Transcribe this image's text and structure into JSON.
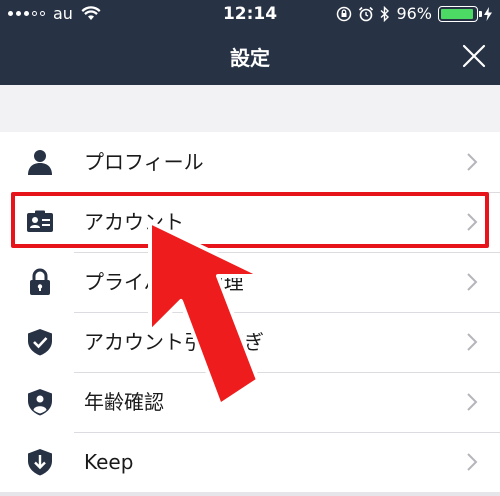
{
  "status_bar": {
    "carrier": "au",
    "time": "12:14",
    "battery_percent_text": "96%",
    "battery_level": 0.96,
    "icons": [
      "wifi-icon",
      "lock-rotation-icon",
      "alarm-icon",
      "bluetooth-icon",
      "battery-icon",
      "charging-icon"
    ]
  },
  "header": {
    "title": "設定",
    "close_icon": "close-icon"
  },
  "settings": {
    "items": [
      {
        "label": "プロフィール",
        "icon": "person-icon"
      },
      {
        "label": "アカウント",
        "icon": "id-card-icon"
      },
      {
        "label": "プライバシー管理",
        "icon": "lock-icon"
      },
      {
        "label": "アカウント引き継ぎ",
        "icon": "shield-check-icon"
      },
      {
        "label": "年齢確認",
        "icon": "shield-person-icon"
      },
      {
        "label": "Keep",
        "icon": "keep-download-icon"
      }
    ]
  },
  "colors": {
    "header_bg": "#273244",
    "icon": "#273244",
    "highlight": "#e8141b",
    "battery": "#4cd964"
  }
}
